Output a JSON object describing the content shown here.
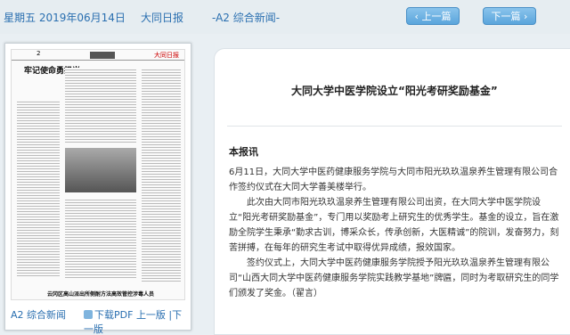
{
  "header": {
    "date": "星期五 2019年06月14日",
    "paper_name": "大同日报",
    "section": "-A2 综合新闻-",
    "prev_label": "上一篇",
    "next_label": "下一篇"
  },
  "thumbnail": {
    "page_num": "2",
    "page_title": "牢记使命勇担当",
    "masthead": "大同日报",
    "bottom_headline": "云冈区高山派出所侧耐方法高效管控涉毒人员"
  },
  "left_footer": {
    "page_link": "A2 综合新闻",
    "pdf_label": "下载PDF",
    "prev_page": "上一版",
    "next_page": "下一版"
  },
  "article": {
    "title": "大同大学中医学院设立“阳光考研奖励基金”",
    "byline": "本报讯",
    "paragraphs": [
      "6月11日，大同大学中医药健康服务学院与大同市阳光玖玖温泉养生管理有限公司合作签约仪式在大同大学善美楼举行。",
      "此次由大同市阳光玖玖温泉养生管理有限公司出资，在大同大学中医学院设立“阳光考研奖励基金”，专门用以奖励考上研究生的优秀学生。基金的设立，旨在激励全院学生秉承“勤求古训，博采众长，传承创新，大医精诚”的院训，发奋努力，刻苦拼搏，在每年的研究生考试中取得优异成绩，报效国家。",
      "签约仪式上，大同大学中医药健康服务学院授予阳光玖玖温泉养生管理有限公司“山西大同大学中医药健康服务学院实践教学基地”牌匾，同时为考取研究生的同学们颁发了奖金。（翟言）"
    ]
  }
}
